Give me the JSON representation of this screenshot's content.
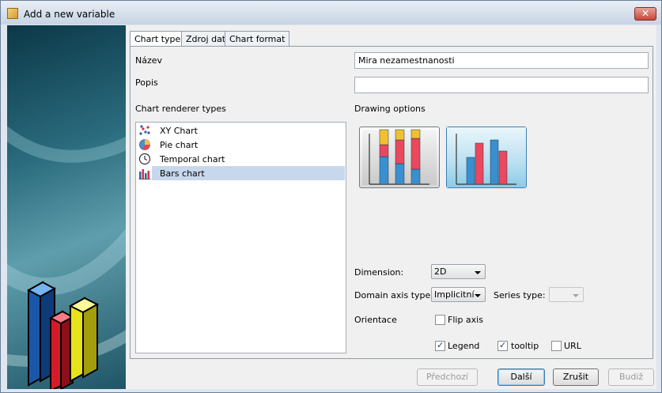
{
  "window": {
    "title": "Add a new variable",
    "close_symbol": "✕"
  },
  "tabs": [
    {
      "label": "Chart type",
      "active": true
    },
    {
      "label": "Zdroj dat",
      "active": false
    },
    {
      "label": "Chart format",
      "active": false
    }
  ],
  "form": {
    "name_label": "Název",
    "name_value": "Mira nezamestnanosti",
    "desc_label": "Popis",
    "desc_value": ""
  },
  "renderer": {
    "label": "Chart renderer types",
    "items": [
      {
        "label": "XY Chart",
        "icon": "scatter-chart-icon",
        "selected": false
      },
      {
        "label": "Pie chart",
        "icon": "pie-chart-icon",
        "selected": false
      },
      {
        "label": "Temporal chart",
        "icon": "clock-icon",
        "selected": false
      },
      {
        "label": "Bars chart",
        "icon": "bar-chart-icon",
        "selected": true
      }
    ]
  },
  "drawing": {
    "label": "Drawing options",
    "options": [
      {
        "icon": "stacked-bar-chart-icon",
        "selected": false
      },
      {
        "icon": "grouped-bar-chart-icon",
        "selected": true
      }
    ]
  },
  "settings": {
    "dimension_label": "Dimension:",
    "dimension_value": "2D",
    "domain_axis_label": "Domain axis type:",
    "domain_axis_value": "Implicitní",
    "series_type_label": "Series type:",
    "series_type_value": "",
    "orientation_label": "Orientace",
    "flip_axis_label": "Flip axis",
    "flip_axis_checked": false,
    "legend_label": "Legend",
    "legend_checked": true,
    "tooltip_label": "tooltip",
    "tooltip_checked": true,
    "url_label": "URL",
    "url_checked": false
  },
  "buttons": {
    "prev": "Předchozí",
    "next": "Další",
    "cancel": "Zrušit",
    "finish": "Budiž"
  },
  "colors": {
    "selection": "#c7d7ec",
    "bar_blue": "#3a8fd0",
    "bar_red": "#e9485e",
    "bar_yellow": "#f0c030"
  }
}
